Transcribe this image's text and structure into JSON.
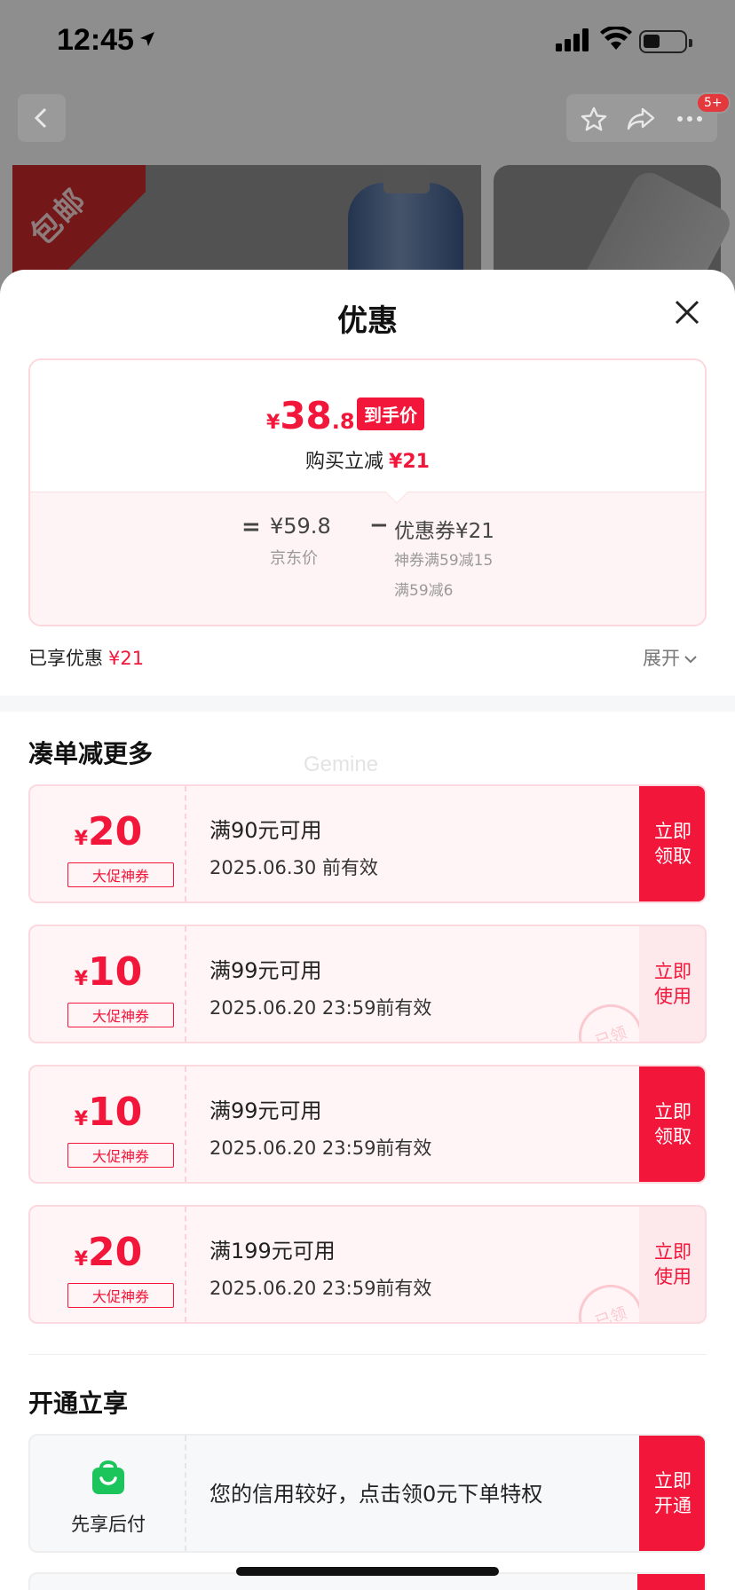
{
  "status_bar": {
    "time": "12:45"
  },
  "top_nav": {
    "more_badge": "5+"
  },
  "background": {
    "ribbon_text": "包邮"
  },
  "sheet": {
    "title": "优惠",
    "price_summary": {
      "currency": "¥",
      "final_price_int": "38",
      "final_price_dec": ".8",
      "final_price_tag": "到手价",
      "instant_reduce_label": "购买立减",
      "instant_reduce_value": "¥21",
      "equals": "=",
      "jd_price": "¥59.8",
      "jd_price_label": "京东价",
      "minus": "−",
      "coupon_total": "优惠券¥21",
      "coupon_detail_1": "神券满59减15",
      "coupon_detail_2": "满59减6"
    },
    "enjoyed_label": "已享优惠",
    "enjoyed_value": "¥21",
    "expand_label": "展开",
    "more_section_title": "凑单减更多",
    "watermark": "Gemine",
    "coupons": [
      {
        "currency": "¥",
        "amount": "20",
        "tag": "大促神券",
        "condition": "满90元可用",
        "validity": "2025.06.30 前有效",
        "button": "立即领取",
        "button_style": "solid",
        "claimed_stamp": ""
      },
      {
        "currency": "¥",
        "amount": "10",
        "tag": "大促神券",
        "condition": "满99元可用",
        "validity": "2025.06.20 23:59前有效",
        "button": "立即使用",
        "button_style": "soft",
        "claimed_stamp": "已领"
      },
      {
        "currency": "¥",
        "amount": "10",
        "tag": "大促神券",
        "condition": "满99元可用",
        "validity": "2025.06.20 23:59前有效",
        "button": "立即领取",
        "button_style": "solid",
        "claimed_stamp": ""
      },
      {
        "currency": "¥",
        "amount": "20",
        "tag": "大促神券",
        "condition": "满199元可用",
        "validity": "2025.06.20 23:59前有效",
        "button": "立即使用",
        "button_style": "soft",
        "claimed_stamp": "已领"
      }
    ],
    "open_section_title": "开通立享",
    "service": {
      "label": "先享后付",
      "description": "您的信用较好，点击领0元下单特权",
      "button": "立即开通"
    }
  },
  "colors": {
    "accent": "#f2163a",
    "coupon_bg": "#fff5f6",
    "service_icon": "#1cc55b"
  }
}
